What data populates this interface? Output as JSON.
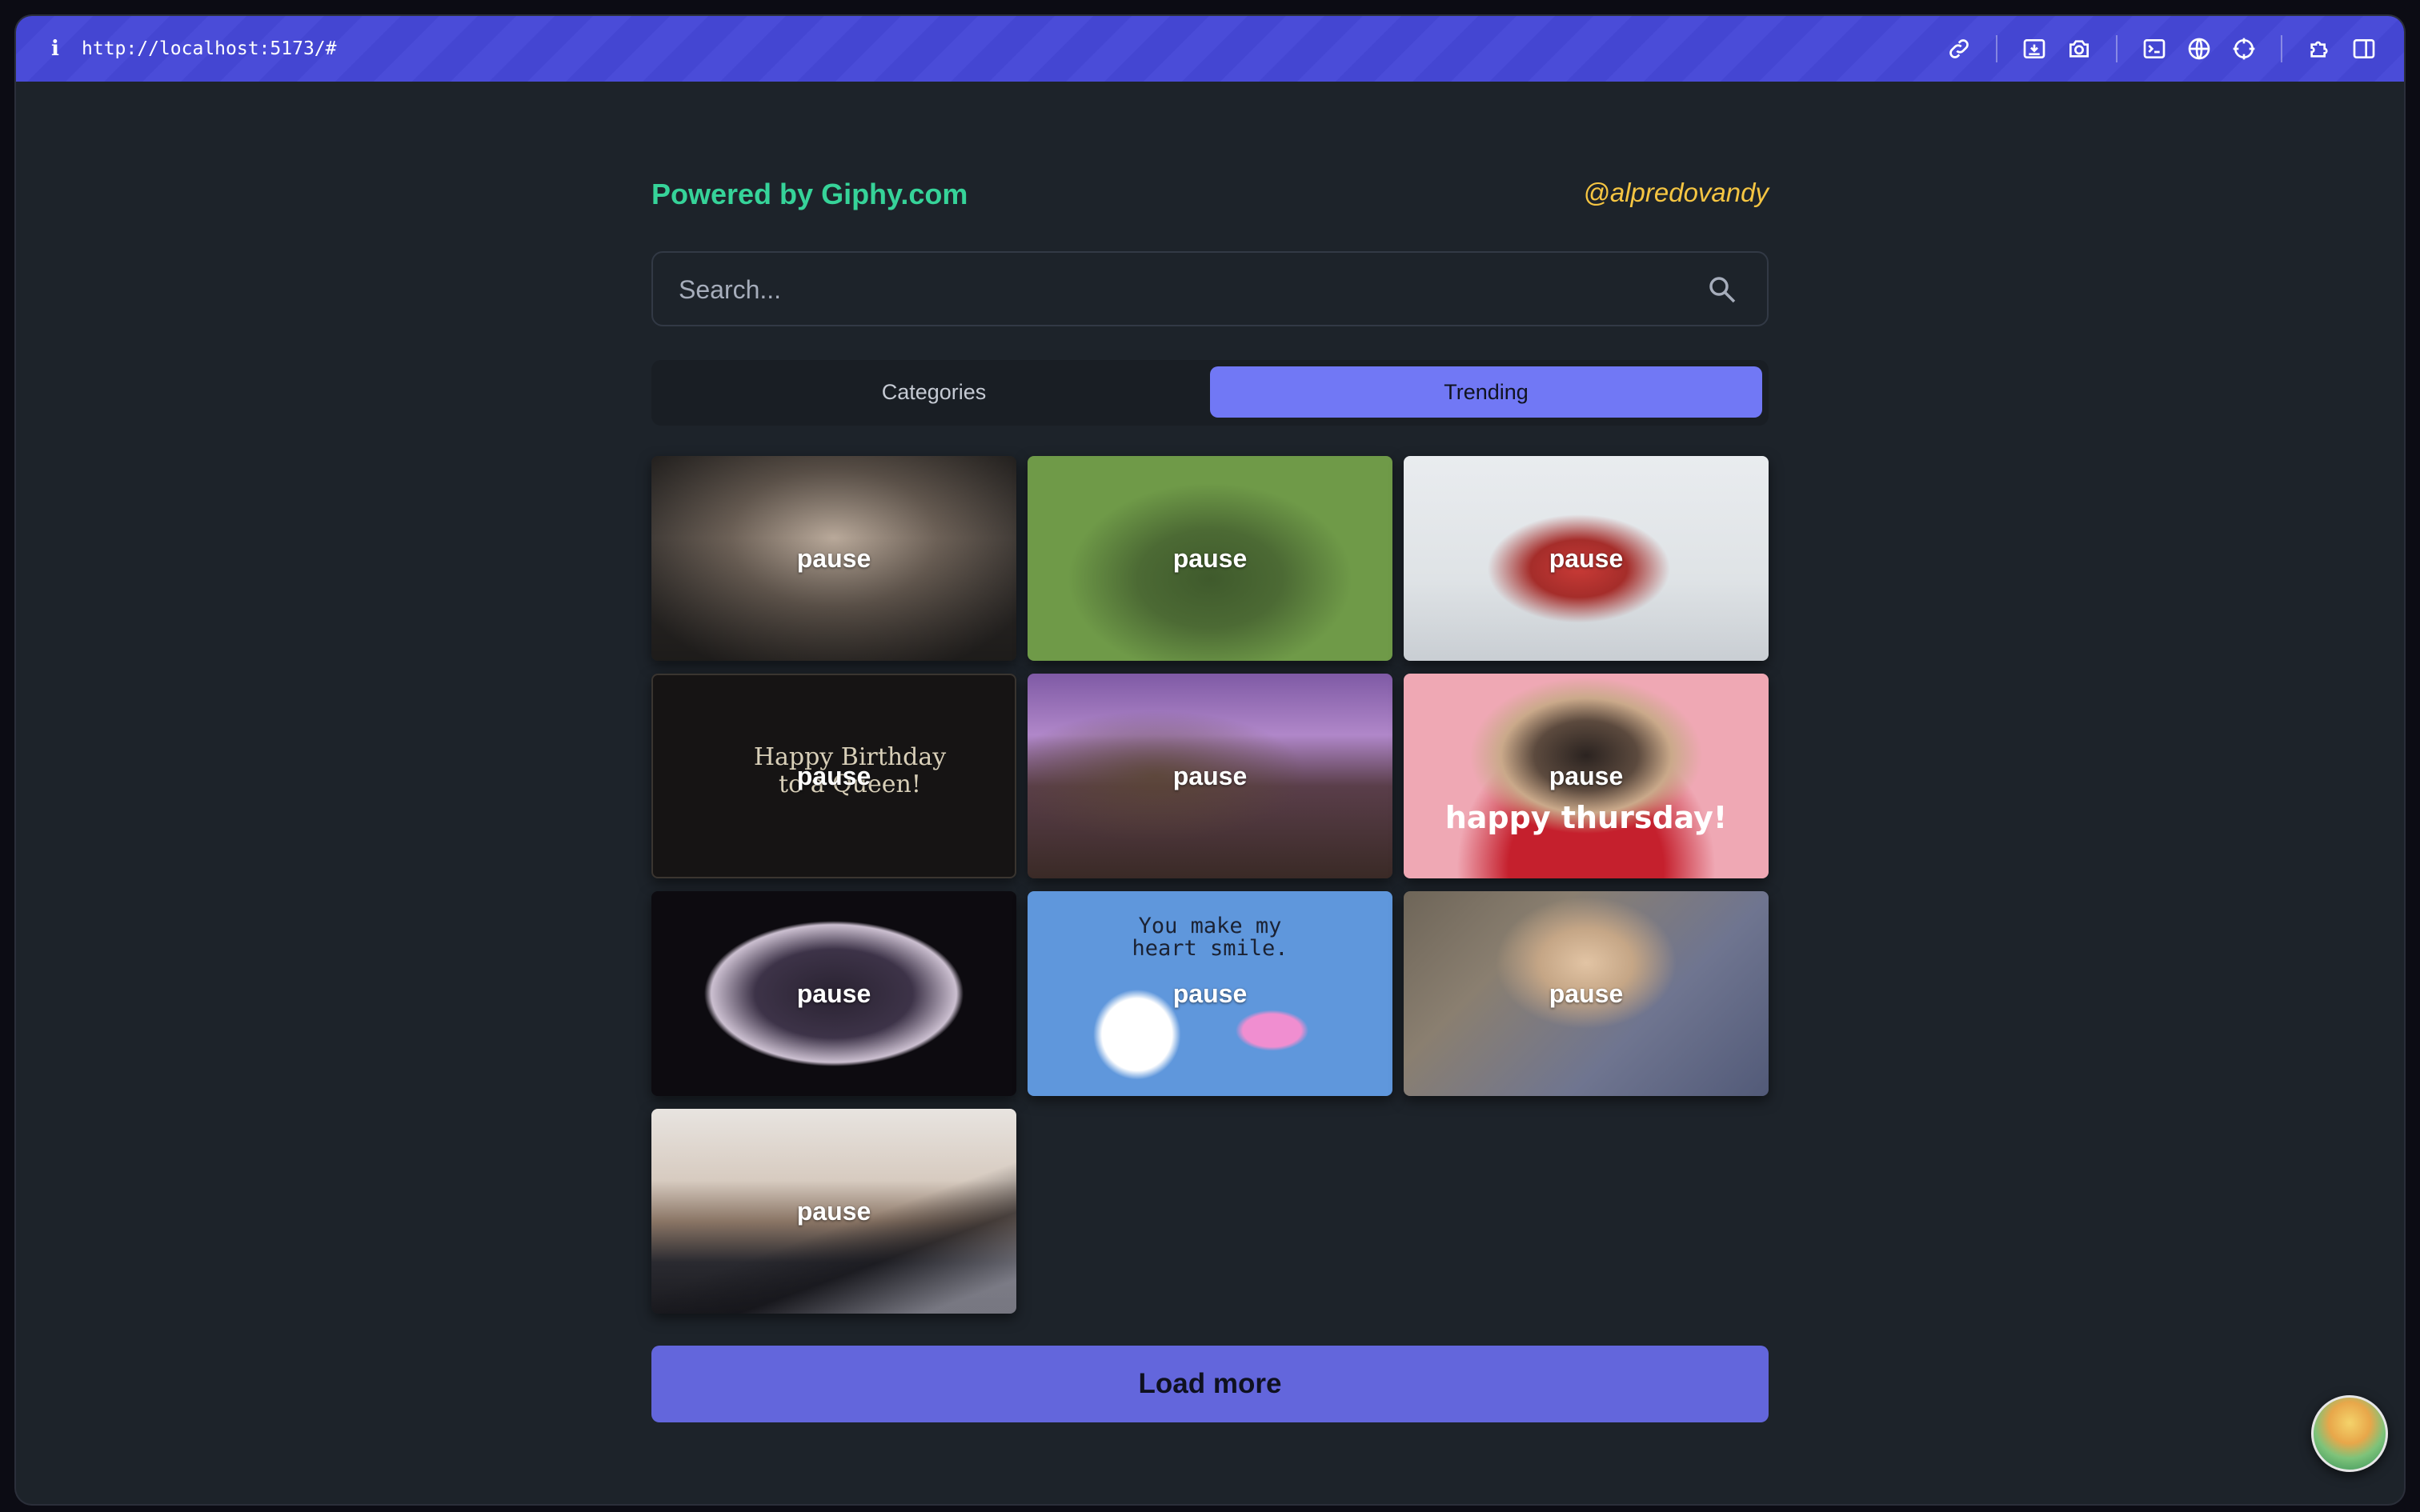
{
  "browser": {
    "info_glyph": "i",
    "url": "http://localhost:5173/#",
    "toolbar_icons": [
      "link-icon",
      "save-page-icon",
      "camera-icon",
      "terminal-icon",
      "globe-icon",
      "crosshair-icon",
      "extension-icon",
      "sidebar-icon"
    ]
  },
  "header": {
    "powered_by": "Powered by Giphy.com",
    "handle": "@alpredovandy"
  },
  "search": {
    "placeholder": "Search...",
    "value": ""
  },
  "tabs": [
    {
      "label": "Categories",
      "active": false
    },
    {
      "label": "Trending",
      "active": true
    }
  ],
  "gifs": [
    {
      "label": "pause",
      "caption": ""
    },
    {
      "label": "pause",
      "caption": ""
    },
    {
      "label": "pause",
      "caption": ""
    },
    {
      "label": "pause",
      "caption": "Happy Birthday to a Queen!"
    },
    {
      "label": "pause",
      "caption": ""
    },
    {
      "label": "pause",
      "caption": "happy thursday!"
    },
    {
      "label": "pause",
      "caption": ""
    },
    {
      "label": "pause",
      "caption": "You make my heart smile."
    },
    {
      "label": "pause",
      "caption": ""
    },
    {
      "label": "pause",
      "caption": ""
    }
  ],
  "load_more": "Load more",
  "colors": {
    "topbar": "#4446d2",
    "powered_by": "#36d399",
    "handle": "#f5c542",
    "active_tab": "#7178f5",
    "load_more": "#6366dc",
    "background": "#1d232a"
  }
}
